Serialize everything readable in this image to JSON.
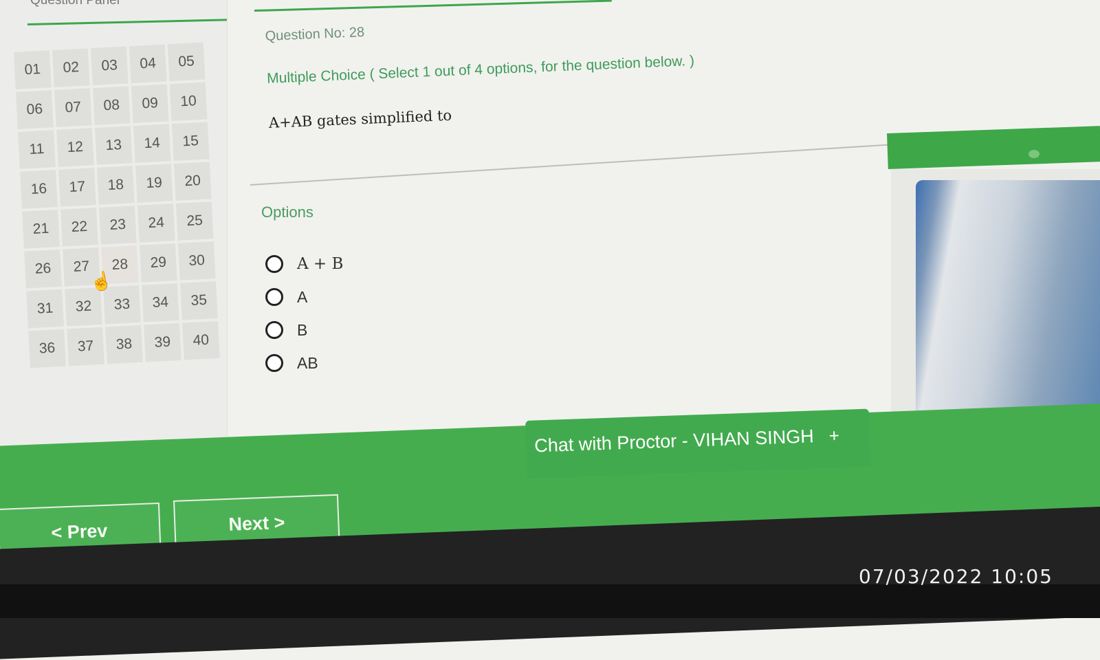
{
  "left_panel": {
    "title": "Question Panel",
    "questions": [
      "01",
      "02",
      "03",
      "04",
      "05",
      "06",
      "07",
      "08",
      "09",
      "10",
      "11",
      "12",
      "13",
      "14",
      "15",
      "16",
      "17",
      "18",
      "19",
      "20",
      "21",
      "22",
      "23",
      "24",
      "25",
      "26",
      "27",
      "28",
      "29",
      "30",
      "31",
      "32",
      "33",
      "34",
      "35",
      "36",
      "37",
      "38",
      "39",
      "40"
    ],
    "current": "28"
  },
  "question": {
    "number_label": "Question No: 28",
    "type_label": "Multiple Choice ( Select 1 out of 4 options, for the question below. )",
    "text": "A+AB gates simplified to"
  },
  "options": {
    "label": "Options",
    "items": [
      "A + B",
      "A",
      "B",
      "AB"
    ]
  },
  "chat": {
    "label": "Chat with Proctor - VIHAN SINGH",
    "plus": "+"
  },
  "nav": {
    "prev_label": "< Prev",
    "next_label": "Next >"
  },
  "timestamp": "07/03/2022 10:05",
  "colors": {
    "accent_green": "#3fa54d",
    "panel_bg": "#ecedea",
    "button_bg": "#dfe0dc"
  },
  "icons": {
    "cursor": "hand-pointer-icon",
    "radio": "radio-circle-icon"
  }
}
